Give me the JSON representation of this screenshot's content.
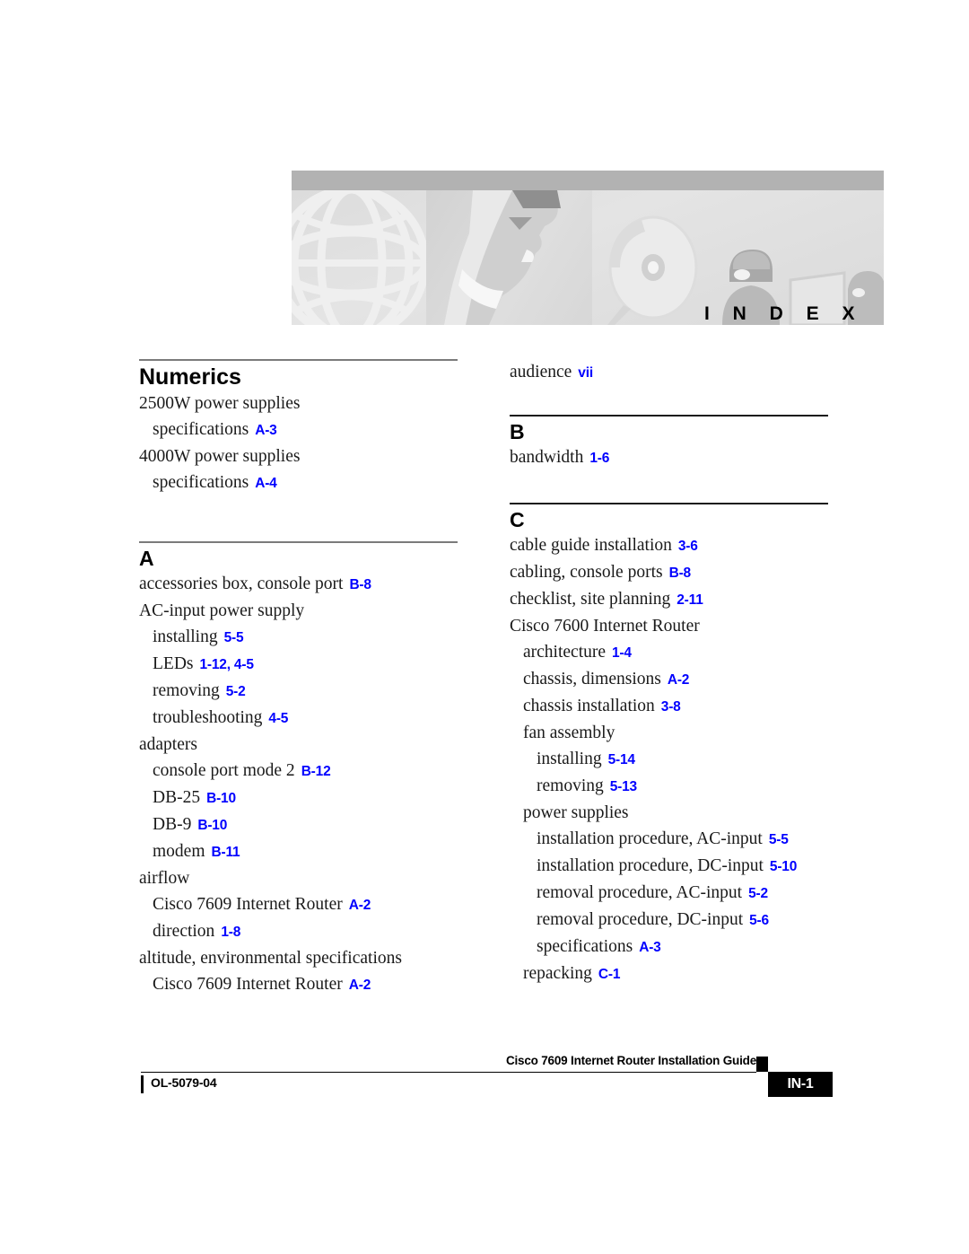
{
  "banner": {
    "index_label": "I N D E X",
    "art_description": "grayscale illustration: globe wireframe, profile face, compact disc, person at computer"
  },
  "colors": {
    "page_ref": "#0000ff",
    "rule": "#7b7b7b",
    "banner_topbar": "#b2b2b2",
    "footer_box": "#000000"
  },
  "columns": {
    "left": {
      "sections": [
        {
          "title": "Numerics",
          "entries": [
            {
              "level": 0,
              "text": "2500W power supplies",
              "ref": ""
            },
            {
              "level": 1,
              "text": "specifications",
              "ref": "A-3"
            },
            {
              "level": 0,
              "text": "4000W power supplies",
              "ref": ""
            },
            {
              "level": 1,
              "text": "specifications",
              "ref": "A-4"
            }
          ]
        },
        {
          "title": "A",
          "entries": [
            {
              "level": 0,
              "text": "accessories box, console port",
              "ref": "B-8"
            },
            {
              "level": 0,
              "text": "AC-input power supply",
              "ref": ""
            },
            {
              "level": 1,
              "text": "installing",
              "ref": "5-5"
            },
            {
              "level": 1,
              "text": "LEDs",
              "ref": "1-12, 4-5"
            },
            {
              "level": 1,
              "text": "removing",
              "ref": "5-2"
            },
            {
              "level": 1,
              "text": "troubleshooting",
              "ref": "4-5"
            },
            {
              "level": 0,
              "text": "adapters",
              "ref": ""
            },
            {
              "level": 1,
              "text": "console port mode 2",
              "ref": "B-12"
            },
            {
              "level": 1,
              "text": "DB-25",
              "ref": "B-10"
            },
            {
              "level": 1,
              "text": "DB-9",
              "ref": "B-10"
            },
            {
              "level": 1,
              "text": "modem",
              "ref": "B-11"
            },
            {
              "level": 0,
              "text": "airflow",
              "ref": ""
            },
            {
              "level": 1,
              "text": "Cisco 7609 Internet Router",
              "ref": "A-2"
            },
            {
              "level": 1,
              "text": "direction",
              "ref": "1-8"
            },
            {
              "level": 0,
              "text": "altitude, environmental specifications",
              "ref": ""
            },
            {
              "level": 1,
              "text": "Cisco 7609 Internet Router",
              "ref": "A-2"
            }
          ]
        }
      ]
    },
    "right": {
      "lead_entries": [
        {
          "level": 0,
          "text": "audience",
          "ref": "vii"
        }
      ],
      "sections": [
        {
          "title": "B",
          "entries": [
            {
              "level": 0,
              "text": "bandwidth",
              "ref": "1-6"
            }
          ]
        },
        {
          "title": "C",
          "entries": [
            {
              "level": 0,
              "text": "cable guide installation",
              "ref": "3-6"
            },
            {
              "level": 0,
              "text": "cabling, console ports",
              "ref": "B-8"
            },
            {
              "level": 0,
              "text": "checklist, site planning",
              "ref": "2-11"
            },
            {
              "level": 0,
              "text": "Cisco 7600 Internet Router",
              "ref": ""
            },
            {
              "level": 1,
              "text": "architecture",
              "ref": "1-4"
            },
            {
              "level": 1,
              "text": "chassis, dimensions",
              "ref": "A-2"
            },
            {
              "level": 1,
              "text": "chassis installation",
              "ref": "3-8"
            },
            {
              "level": 1,
              "text": "fan assembly",
              "ref": ""
            },
            {
              "level": 2,
              "text": "installing",
              "ref": "5-14"
            },
            {
              "level": 2,
              "text": "removing",
              "ref": "5-13"
            },
            {
              "level": 1,
              "text": "power supplies",
              "ref": ""
            },
            {
              "level": 2,
              "text": "installation procedure, AC-input",
              "ref": "5-5"
            },
            {
              "level": 2,
              "text": "installation procedure, DC-input",
              "ref": "5-10"
            },
            {
              "level": 2,
              "text": "removal procedure, AC-input",
              "ref": "5-2"
            },
            {
              "level": 2,
              "text": "removal procedure, DC-input",
              "ref": "5-6"
            },
            {
              "level": 2,
              "text": "specifications",
              "ref": "A-3"
            },
            {
              "level": 1,
              "text": "repacking",
              "ref": "C-1"
            }
          ]
        }
      ]
    }
  },
  "footer": {
    "guide_title": "Cisco 7609 Internet Router Installation Guide",
    "doc_id": "OL-5079-04",
    "page_number": "IN-1"
  }
}
